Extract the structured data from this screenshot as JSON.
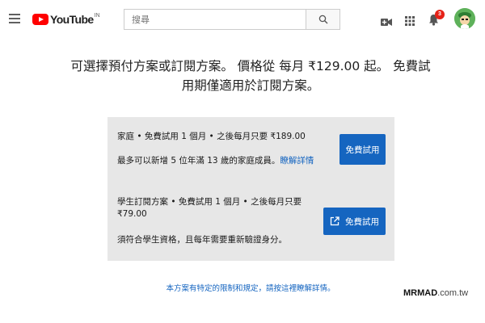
{
  "header": {
    "logo_text": "YouTube",
    "logo_region": "IN",
    "search": {
      "placeholder": "搜尋",
      "value": ""
    },
    "notifications_count": "3"
  },
  "intro": {
    "line1": "可選擇預付方案或訂閱方案。 價格從 每月 ₹129.00 起。 免費試",
    "line2": "用期僅適用於訂閱方案。"
  },
  "plans": [
    {
      "title": "家庭 • 免費試用 1 個月 • 之後每月只要 ₹189.00",
      "desc": "最多可以新增 5 位年滿 13 歲的家庭成員。",
      "link": "瞭解詳情",
      "button": "免費試用"
    },
    {
      "title_line1": "學生訂閱方案 • 免費試用 1 個月 • 之後每月只要",
      "title_line2": "₹79.00",
      "desc": "須符合學生資格，且每年需要重新驗證身分。",
      "button": "免費試用"
    }
  ],
  "footer_note": "本方案有特定的限制和規定，請按這裡瞭解詳情。",
  "watermark": {
    "brand": "MRMAD",
    "domain": ".com.tw"
  },
  "colors": {
    "brand_red": "#ff0000",
    "accent_blue": "#1565c0",
    "panel_bg": "#e7e7e7"
  }
}
